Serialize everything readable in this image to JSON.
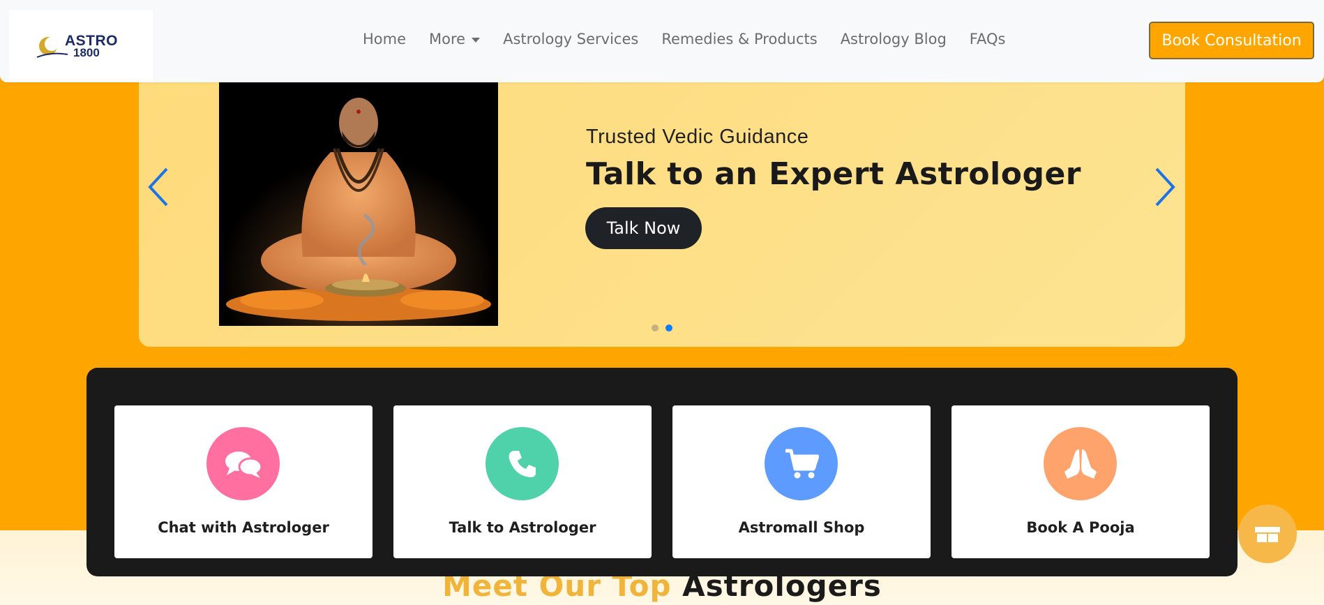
{
  "header": {
    "logo": {
      "line1": "ASTRO",
      "line2": "1800"
    },
    "nav": [
      {
        "label": "Home"
      },
      {
        "label": "More"
      },
      {
        "label": "Astrology Services"
      },
      {
        "label": "Remedies & Products"
      },
      {
        "label": "Astrology Blog"
      },
      {
        "label": "FAQs"
      }
    ],
    "cta_label": "Book Consultation"
  },
  "hero": {
    "subtitle": "Trusted Vedic Guidance",
    "title": "Talk to an Expert Astrologer",
    "button_label": "Talk Now",
    "slide_count": 2,
    "active_slide": 2,
    "image": "meditating-monk-with-incense"
  },
  "services": [
    {
      "label": "Chat with Astrologer",
      "icon": "chat-bubbles-icon",
      "color": "#ff6f9f"
    },
    {
      "label": "Talk to Astrologer",
      "icon": "phone-icon",
      "color": "#4fd1aa"
    },
    {
      "label": "Astromall Shop",
      "icon": "shopping-cart-icon",
      "color": "#5d9bff"
    },
    {
      "label": "Book A Pooja",
      "icon": "praying-hands-icon",
      "color": "#ffa36c"
    }
  ],
  "section": {
    "title_highlight": "Meet Our Top",
    "title_rest": "Astrologers"
  },
  "colors": {
    "brand": "#ffa500",
    "dark": "#1a1a1a",
    "accent_blue": "#0a7cff"
  }
}
